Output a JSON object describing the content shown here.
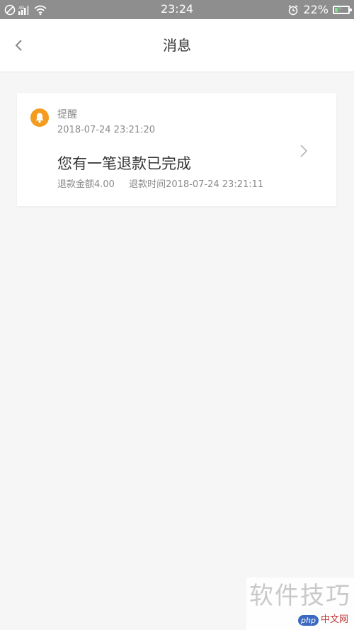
{
  "status_bar": {
    "time": "23:24",
    "battery_percent": "22%",
    "battery_level": 0.22,
    "icons": [
      "no-sim-icon",
      "signal-icon",
      "wifi-icon",
      "alarm-icon",
      "battery-charging-icon"
    ]
  },
  "nav": {
    "title": "消息",
    "back_icon": "back-arrow-icon"
  },
  "message": {
    "type_label": "提醒",
    "timestamp": "2018-07-24  23:21:20",
    "title": "您有一笔退款已完成",
    "refund_amount": "退款金额4.00",
    "refund_time": "退款时间2018-07-24 23:21:11",
    "icon": "bell-icon",
    "accent_color": "#f39c1f"
  },
  "watermark": {
    "text": "软件技巧",
    "logo_badge": "php",
    "logo_site": "中文网"
  }
}
